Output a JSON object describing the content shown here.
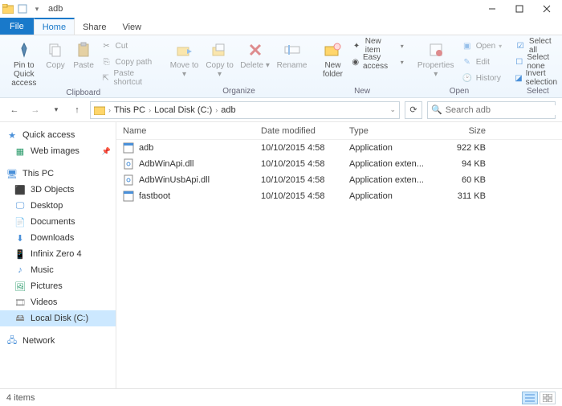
{
  "window": {
    "title": "adb"
  },
  "tabs": {
    "file": "File",
    "home": "Home",
    "share": "Share",
    "view": "View"
  },
  "ribbon": {
    "clipboard": {
      "label": "Clipboard",
      "pin": "Pin to Quick access",
      "copy": "Copy",
      "paste": "Paste",
      "cut": "Cut",
      "copypath": "Copy path",
      "pasteshortcut": "Paste shortcut"
    },
    "organize": {
      "label": "Organize",
      "moveto": "Move to",
      "copyto": "Copy to",
      "delete": "Delete",
      "rename": "Rename"
    },
    "new": {
      "label": "New",
      "newfolder": "New folder",
      "newitem": "New item",
      "easyaccess": "Easy access"
    },
    "open": {
      "label": "Open",
      "properties": "Properties",
      "open": "Open",
      "edit": "Edit",
      "history": "History"
    },
    "select": {
      "label": "Select",
      "selectall": "Select all",
      "selectnone": "Select none",
      "invert": "Invert selection"
    }
  },
  "breadcrumb": {
    "root": "This PC",
    "drive": "Local Disk (C:)",
    "folder": "adb"
  },
  "search": {
    "placeholder": "Search adb"
  },
  "nav": {
    "quickaccess": "Quick access",
    "webimages": "Web images",
    "thispc": "This PC",
    "objects3d": "3D Objects",
    "desktop": "Desktop",
    "documents": "Documents",
    "downloads": "Downloads",
    "infinix": "Infinix Zero 4",
    "music": "Music",
    "pictures": "Pictures",
    "videos": "Videos",
    "localdisk": "Local Disk (C:)",
    "network": "Network"
  },
  "columns": {
    "name": "Name",
    "date": "Date modified",
    "type": "Type",
    "size": "Size"
  },
  "files": [
    {
      "name": "adb",
      "date": "10/10/2015 4:58",
      "type": "Application",
      "size": "922 KB",
      "icon": "exe"
    },
    {
      "name": "AdbWinApi.dll",
      "date": "10/10/2015 4:58",
      "type": "Application exten...",
      "size": "94 KB",
      "icon": "dll"
    },
    {
      "name": "AdbWinUsbApi.dll",
      "date": "10/10/2015 4:58",
      "type": "Application exten...",
      "size": "60 KB",
      "icon": "dll"
    },
    {
      "name": "fastboot",
      "date": "10/10/2015 4:58",
      "type": "Application",
      "size": "311 KB",
      "icon": "exe"
    }
  ],
  "status": {
    "items": "4 items"
  }
}
